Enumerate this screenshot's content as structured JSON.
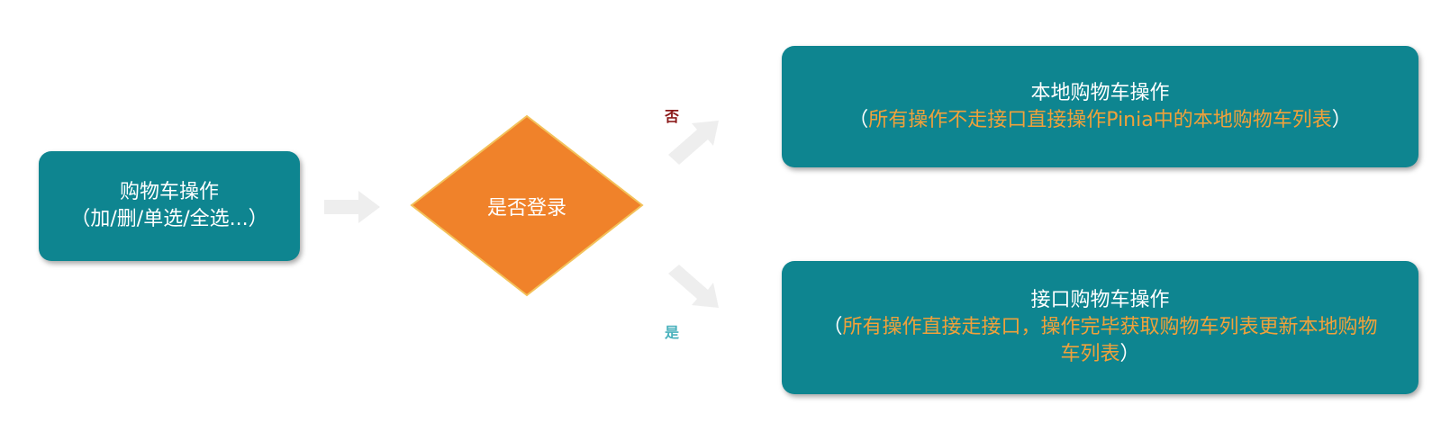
{
  "start": {
    "title": "购物车操作",
    "subtitle": "（加/删/单选/全选...）"
  },
  "decision": {
    "label": "是否登录"
  },
  "branch_no": {
    "label": "否"
  },
  "branch_yes": {
    "label": "是"
  },
  "local": {
    "title": "本地购物车操作",
    "open": "（",
    "detail": "所有操作不走接口直接操作Pinia中的本地购物车列表",
    "close": "）"
  },
  "api": {
    "title": "接口购物车操作",
    "open": "（",
    "detail": "所有操作直接走接口，操作完毕获取购物车列表更新本地购物车列表",
    "close": "）"
  },
  "colors": {
    "box": "#0e8590",
    "decision": "#f0822a",
    "highlight_text": "#f0a13a",
    "arrow": "#eeeeee",
    "no_label": "#8b1a1a",
    "yes_label": "#4ab2bd"
  }
}
